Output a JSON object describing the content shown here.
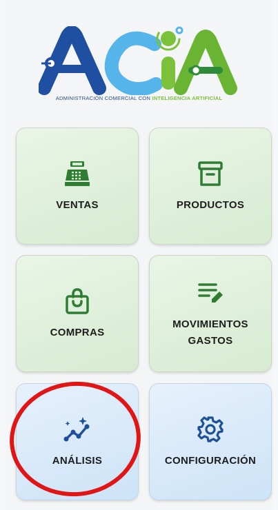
{
  "brand": {
    "logo_text": "ACIA",
    "tagline_prefix": "ADMINISTRACIÓN COMERCIAL CON ",
    "tagline_highlight": "INTELIGENCIA ARTIFICIAL"
  },
  "menu": {
    "tiles": [
      {
        "label": "VENTAS",
        "icon": "cash-register-icon",
        "theme": "green"
      },
      {
        "label": "PRODUCTOS",
        "icon": "archive-box-icon",
        "theme": "green"
      },
      {
        "label": "COMPRAS",
        "icon": "shopping-bag-icon",
        "theme": "green"
      },
      {
        "label": "MOVIMIENTOS\nGASTOS",
        "icon": "edit-list-icon",
        "theme": "green"
      },
      {
        "label": "ANÁLISIS",
        "icon": "sparkle-chart-icon",
        "theme": "blue"
      },
      {
        "label": "CONFIGURACIÓN",
        "icon": "gear-icon",
        "theme": "blue"
      }
    ]
  },
  "colors": {
    "green_icon": "#2e7d32",
    "blue_icon": "#1e4f99",
    "highlight_ring": "#e01616"
  }
}
